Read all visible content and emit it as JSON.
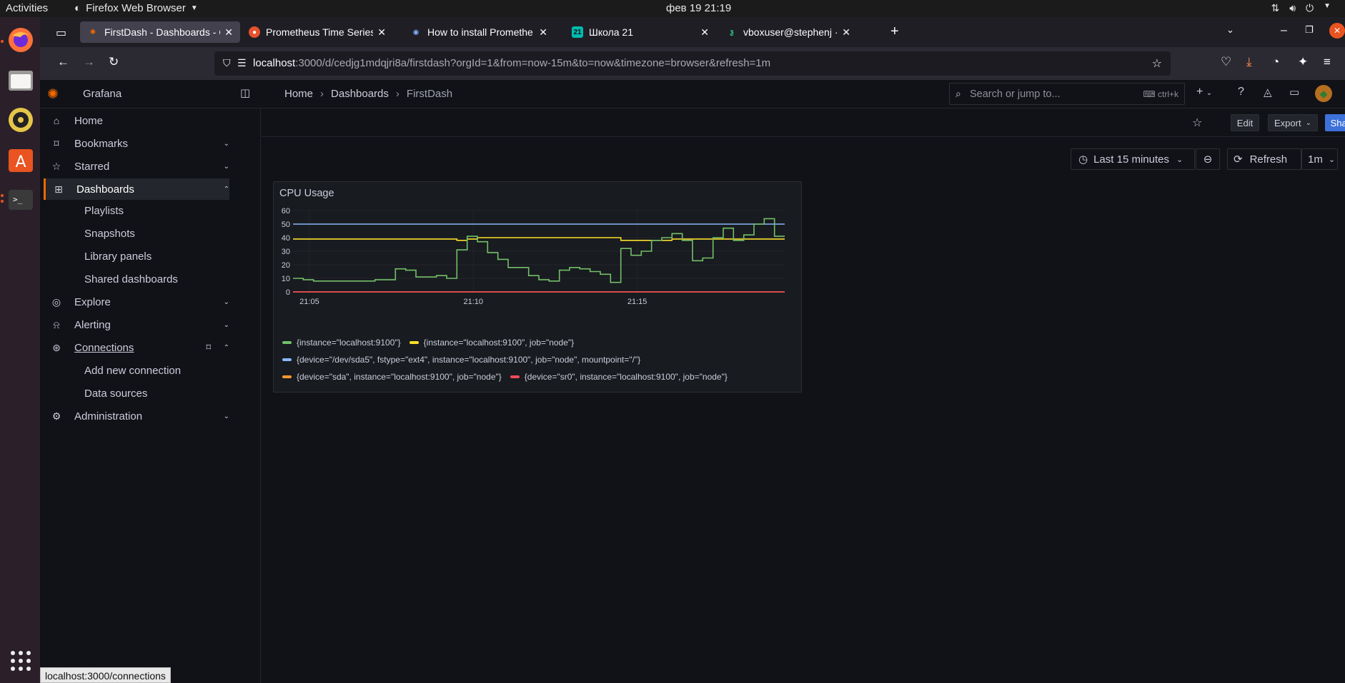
{
  "topbar": {
    "activities": "Activities",
    "app_name": "Firefox Web Browser",
    "clock": "фев 19  21:19"
  },
  "browser": {
    "tabs": [
      {
        "title": "FirstDash - Dashboards - G",
        "icon": "grafana-icon",
        "active": true
      },
      {
        "title": "Prometheus Time Series C",
        "icon": "prometheus-icon",
        "active": false
      },
      {
        "title": "How to install Promethe",
        "icon": "eye-icon",
        "active": false
      },
      {
        "title": "Школа 21",
        "icon": "school21-icon",
        "active": false
      },
      {
        "title": "vboxuser@stephenj · SSH",
        "icon": "ssh-icon",
        "active": false
      }
    ],
    "url_host": "localhost",
    "url_path": ":3000/d/cedjg1mdqjri8a/firstdash?orgId=1&from=now-15m&to=now&timezone=browser&refresh=1m"
  },
  "grafana": {
    "brand": "Grafana",
    "breadcrumb": [
      "Home",
      "Dashboards",
      "FirstDash"
    ],
    "search_placeholder": "Search or jump to...",
    "search_shortcut": "ctrl+k",
    "sidebar": [
      {
        "label": "Home",
        "icon": "home-icon",
        "chevron": ""
      },
      {
        "label": "Bookmarks",
        "icon": "bookmark-icon",
        "chevron": "down"
      },
      {
        "label": "Starred",
        "icon": "star-icon",
        "chevron": "down"
      },
      {
        "label": "Dashboards",
        "icon": "apps-icon",
        "chevron": "up",
        "active": true
      },
      {
        "label": "Explore",
        "icon": "compass-icon",
        "chevron": "down"
      },
      {
        "label": "Alerting",
        "icon": "bell-icon",
        "chevron": "down"
      },
      {
        "label": "Connections",
        "icon": "connections-icon",
        "chevron": "up",
        "underline": true
      },
      {
        "label": "Administration",
        "icon": "cog-icon",
        "chevron": "down"
      }
    ],
    "dashboards_sub": [
      "Playlists",
      "Snapshots",
      "Library panels",
      "Shared dashboards"
    ],
    "connections_sub": [
      "Add new connection",
      "Data sources"
    ],
    "toolbar": {
      "edit": "Edit",
      "export": "Export",
      "share": "Share"
    },
    "time_picker": "Last 15 minutes",
    "refresh": "Refresh",
    "refresh_interval": "1m",
    "panel_title": "CPU Usage"
  },
  "chart_data": {
    "type": "line",
    "title": "CPU Usage",
    "ylim": [
      0,
      60
    ],
    "y_ticks": [
      0,
      10,
      20,
      30,
      40,
      50,
      60
    ],
    "x_ticks": [
      "21:05",
      "21:10",
      "21:15"
    ],
    "x_start": "21:04:30",
    "x_end": "21:19:30",
    "series": [
      {
        "name": "{instance=\"localhost:9100\"}",
        "color": "#73bf69",
        "x_minutes": [
          0,
          0.5,
          1,
          1.5,
          2,
          2.5,
          3,
          3.5,
          4,
          4.5,
          5,
          5.25,
          5.5,
          6,
          6.5,
          7,
          7.5,
          8,
          8.5,
          9,
          9.5,
          10,
          10.5,
          11,
          11.5,
          12,
          12.5,
          13,
          13.5,
          14,
          14.5,
          15
        ],
        "values": [
          10,
          9,
          8,
          8,
          8,
          8,
          8,
          8,
          9,
          9,
          17,
          16,
          11,
          11,
          12,
          10,
          31,
          41,
          37,
          29,
          24,
          18,
          18,
          12,
          9,
          8,
          16,
          18,
          17,
          15,
          13,
          7,
          32,
          27,
          30,
          38,
          40,
          43,
          38,
          23,
          25,
          40,
          47,
          38,
          42,
          50,
          54,
          41
        ]
      },
      {
        "name": "{instance=\"localhost:9100\", job=\"node\"}",
        "color": "#fade2a",
        "values": [
          39,
          39,
          39,
          39,
          39,
          39,
          39,
          39,
          39,
          39,
          39,
          39,
          39,
          39,
          39,
          39,
          38,
          39,
          40,
          40,
          40,
          40,
          40,
          40,
          40,
          40,
          40,
          40,
          40,
          40,
          40,
          40,
          38,
          38,
          38,
          38,
          38,
          39,
          39,
          39,
          39,
          39,
          39,
          39,
          39,
          39,
          39,
          39
        ]
      },
      {
        "name": "{device=\"/dev/sda5\", fstype=\"ext4\", instance=\"localhost:9100\", job=\"node\", mountpoint=\"/\"}",
        "color": "#8ab8ff",
        "values": [
          50,
          50,
          50,
          50,
          50,
          50,
          50,
          50,
          50,
          50,
          50,
          50,
          50,
          50,
          50,
          50,
          50,
          50,
          50,
          50,
          50,
          50,
          50,
          50,
          50,
          50,
          50,
          50,
          50,
          50,
          50,
          50,
          50,
          50,
          50,
          50,
          50,
          50,
          50,
          50,
          50,
          50,
          50,
          50,
          50,
          50,
          50,
          50
        ]
      },
      {
        "name": "{device=\"sda\", instance=\"localhost:9100\", job=\"node\"}",
        "color": "#ff9830",
        "values": [
          0,
          0,
          0,
          0,
          0,
          0,
          0,
          0,
          0,
          0,
          0,
          0,
          0,
          0,
          0,
          0,
          0,
          0,
          0,
          0,
          0,
          0,
          0,
          0,
          0,
          0,
          0,
          0,
          0,
          0,
          0,
          0,
          0,
          0,
          0,
          0,
          0,
          0,
          0,
          0,
          0,
          0,
          0,
          0,
          0,
          0,
          0,
          0
        ]
      },
      {
        "name": "{device=\"sr0\", instance=\"localhost:9100\", job=\"node\"}",
        "color": "#f2495c",
        "values": [
          0,
          0,
          0,
          0,
          0,
          0,
          0,
          0,
          0,
          0,
          0,
          0,
          0,
          0,
          0,
          0,
          0,
          0,
          0,
          0,
          0,
          0,
          0,
          0,
          0,
          0,
          0,
          0,
          0,
          0,
          0,
          0,
          0,
          0,
          0,
          0,
          0,
          0,
          0,
          0,
          0,
          0,
          0,
          0,
          0,
          0,
          0,
          0
        ]
      }
    ]
  },
  "statusbar": "localhost:3000/connections"
}
